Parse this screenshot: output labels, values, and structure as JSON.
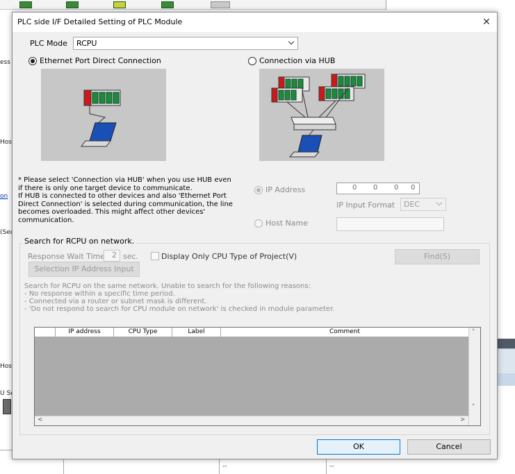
{
  "background": {
    "side_fragments": [
      "ess",
      "Host",
      "on",
      "(Sec",
      "Host",
      "U Se"
    ],
    "bottom_cells": [
      "--",
      "--"
    ]
  },
  "dialog": {
    "title": "PLC side I/F Detailed Setting of PLC Module",
    "close_icon": "close-icon",
    "plc_mode_label": "PLC Mode",
    "plc_mode_value": "RCPU",
    "radio_direct": "Ethernet Port Direct Connection",
    "radio_hub": "Connection via HUB",
    "selected_connection": "direct",
    "note": "* Please select 'Connection via HUB' when you use HUB even if there is only one target device to communicate.\nIf HUB is connected to other devices and also 'Ethernet Port Direct Connection' is selected during communication, the line becomes overloaded. This might affect other devices' communication.",
    "ip_address_label": "IP Address",
    "ip_octets": [
      "0",
      "0",
      "0",
      "0"
    ],
    "ip_input_format_label": "IP Input Format",
    "ip_input_format_value": "DEC",
    "host_name_label": "Host Name",
    "search": {
      "caption": "Search for RCPU on network.",
      "response_wait_label": "Response Wait Time",
      "response_wait_value": "2",
      "response_wait_unit": "sec.",
      "display_only_label": "Display Only CPU Type of Project(V)",
      "find_button": "Find(S)",
      "selection_ip_button": "Selection IP Address Input",
      "reasons_text": "Search for RCPU on the same network. Unable to search for the following reasons:\n- No response within a specific time period.\n- Connected via a router or subnet mask is different.\n- 'Do not respond to search for CPU module on network' is checked in module parameter.",
      "columns": [
        "IP address",
        "CPU Type",
        "Label",
        "Comment"
      ]
    },
    "ok_button": "OK",
    "cancel_button": "Cancel"
  }
}
